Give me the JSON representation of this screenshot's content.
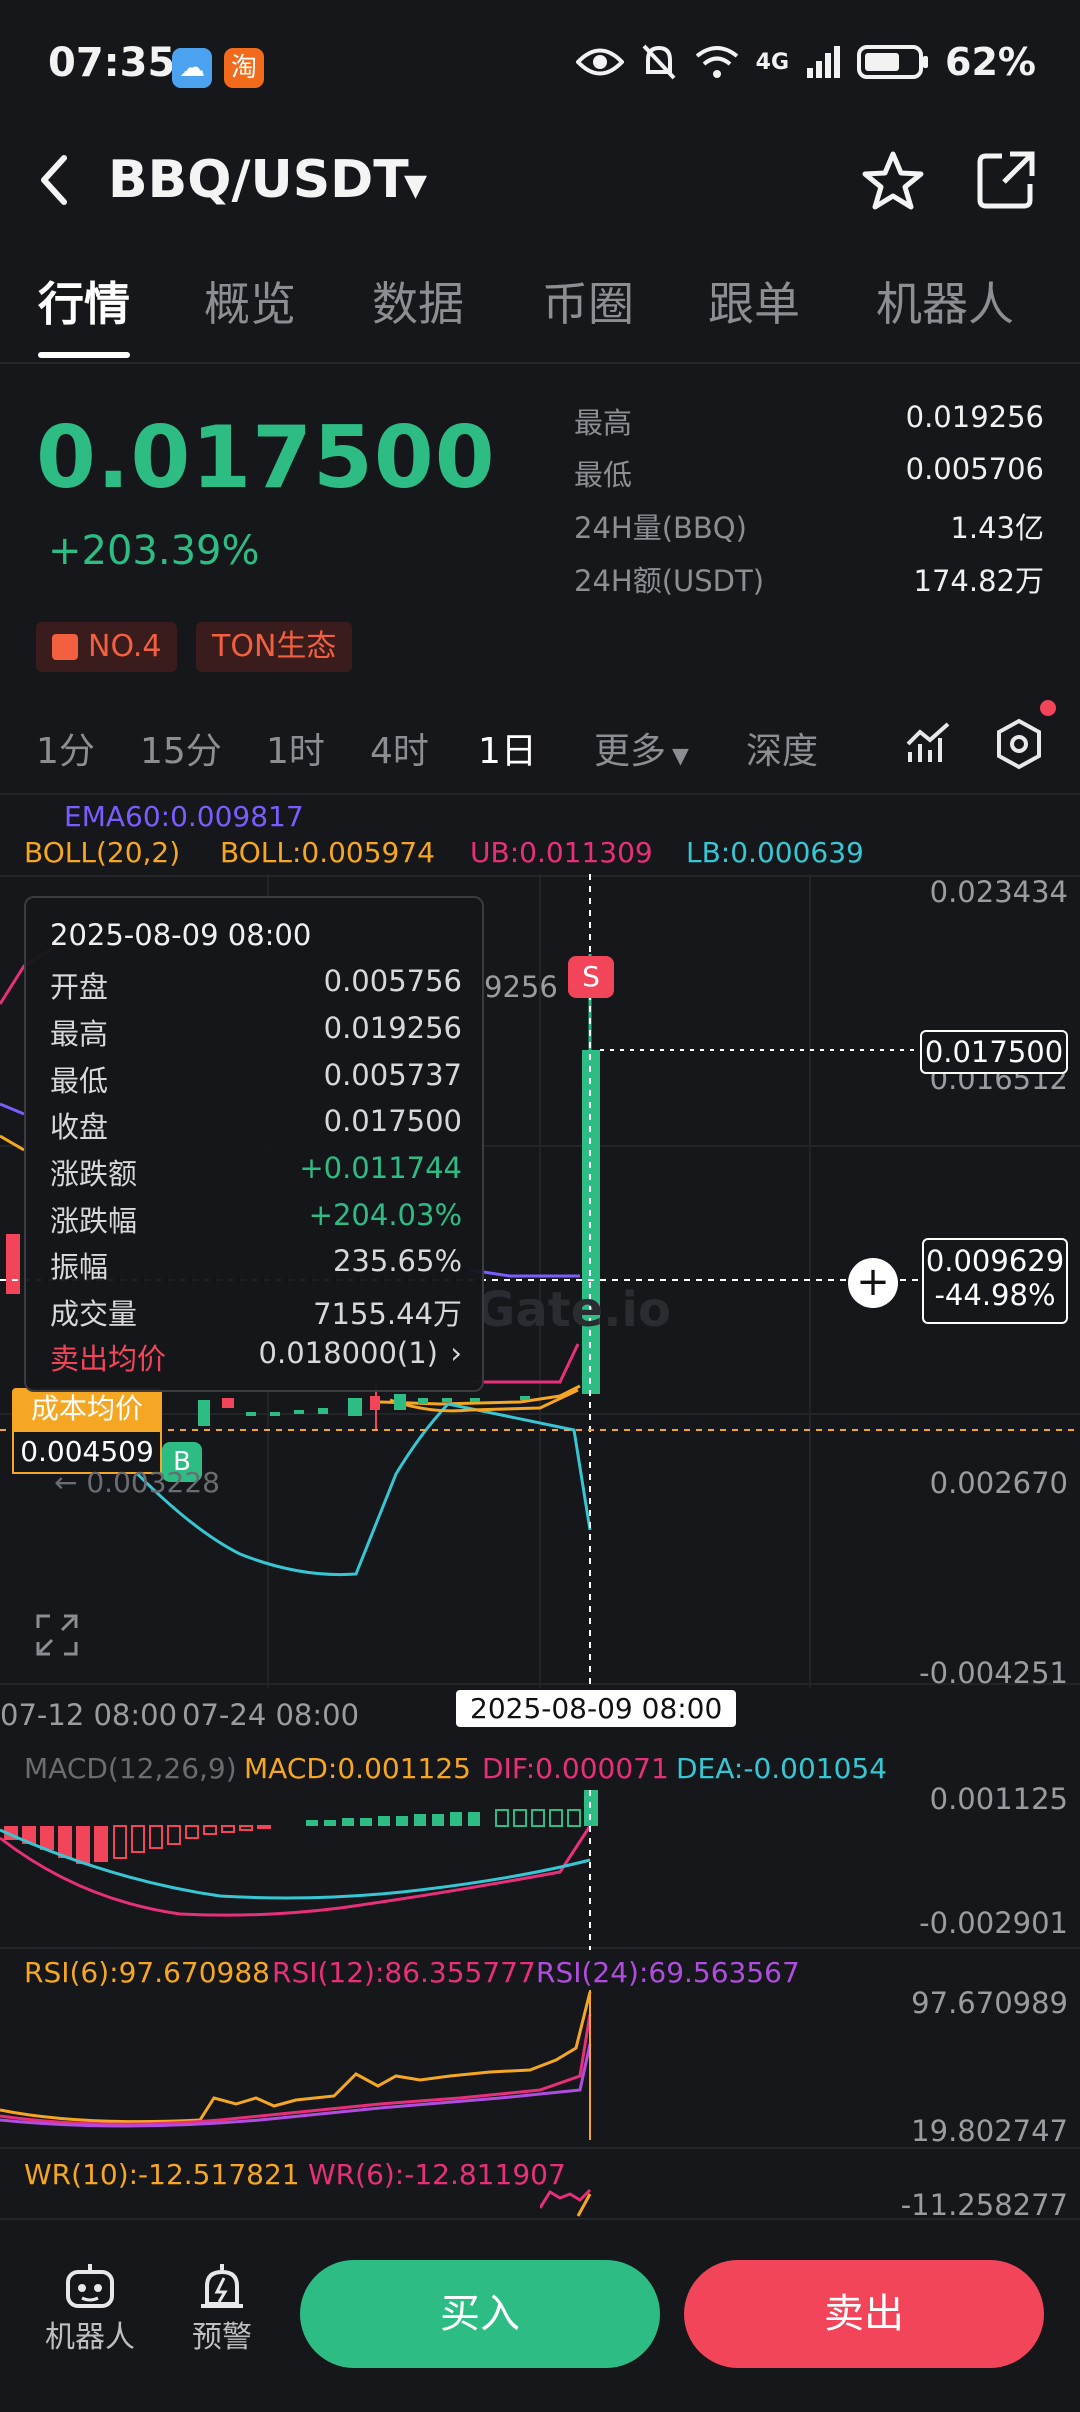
{
  "status_bar": {
    "time": "07:35",
    "network": "4G",
    "battery": "62%",
    "badge_weather": "☁",
    "badge_taobao": "淘"
  },
  "header": {
    "pair": "BBQ/USDT"
  },
  "tabs": [
    "行情",
    "概览",
    "数据",
    "币圈",
    "跟单",
    "机器人"
  ],
  "price": {
    "last": "0.017500",
    "change_pct": "+203.39%",
    "tags": [
      "NO.4",
      "TON生态"
    ],
    "stats": [
      {
        "label": "最高",
        "value": "0.019256"
      },
      {
        "label": "最低",
        "value": "0.005706"
      },
      {
        "label": "24H量(BBQ)",
        "value": "1.43亿"
      },
      {
        "label": "24H额(USDT)",
        "value": "174.82万"
      }
    ]
  },
  "timeframes": [
    "1分",
    "15分",
    "1时",
    "4时",
    "1日",
    "更多",
    "深度"
  ],
  "indicators": {
    "ema": "EMA60:0.009817",
    "boll_name": "BOLL(20,2)",
    "boll": "BOLL:0.005974",
    "ub": "UB:0.011309",
    "lb": "LB:0.000639"
  },
  "main_chart": {
    "axis": [
      "0.023434",
      "0.016512",
      "0.002670",
      "-0.004251"
    ],
    "high_marker": "9256",
    "low_marker": "← 0.003228",
    "price_tag": "0.017500",
    "cross_price": "0.009629",
    "cross_pct": "-44.98%",
    "cost_label": "成本均价",
    "cost_value": "0.004509",
    "sell_marker": "S",
    "buy_marker": "B",
    "watermark": "Gate.io",
    "dates": [
      "07-12 08:00",
      "07-24 08:00"
    ],
    "cursor_date": "2025-08-09 08:00"
  },
  "tooltip": {
    "date": "2025-08-09 08:00",
    "rows": [
      {
        "label": "开盘",
        "value": "0.005756"
      },
      {
        "label": "最高",
        "value": "0.019256"
      },
      {
        "label": "最低",
        "value": "0.005737"
      },
      {
        "label": "收盘",
        "value": "0.017500"
      },
      {
        "label": "涨跌额",
        "value": "+0.011744"
      },
      {
        "label": "涨跌幅",
        "value": "+204.03%"
      },
      {
        "label": "振幅",
        "value": "235.65%"
      },
      {
        "label": "成交量",
        "value": "7155.44万"
      },
      {
        "label": "卖出均价",
        "value": "0.018000(1)"
      }
    ]
  },
  "macd": {
    "name": "MACD(12,26,9)",
    "macd": "MACD:0.001125",
    "dif": "DIF:0.000071",
    "dea": "DEA:-0.001054",
    "axis": [
      "0.001125",
      "-0.002901"
    ]
  },
  "rsi": {
    "rsi6": "RSI(6):97.670988",
    "rsi12": "RSI(12):86.355777",
    "rsi24": "RSI(24):69.563567",
    "axis": [
      "97.670989",
      "19.802747"
    ]
  },
  "wr": {
    "wr10": "WR(10):-12.517821",
    "wr6": "WR(6):-12.811907",
    "axis": "-11.258277"
  },
  "bottom": {
    "robot": "机器人",
    "alert": "预警",
    "buy": "买入",
    "sell": "卖出"
  },
  "colors": {
    "up": "#2dbd84",
    "down": "#f2455a",
    "boll": "#f5a623",
    "ub": "#e8307a",
    "lb": "#37c7d4",
    "ema": "#7a5cff"
  }
}
